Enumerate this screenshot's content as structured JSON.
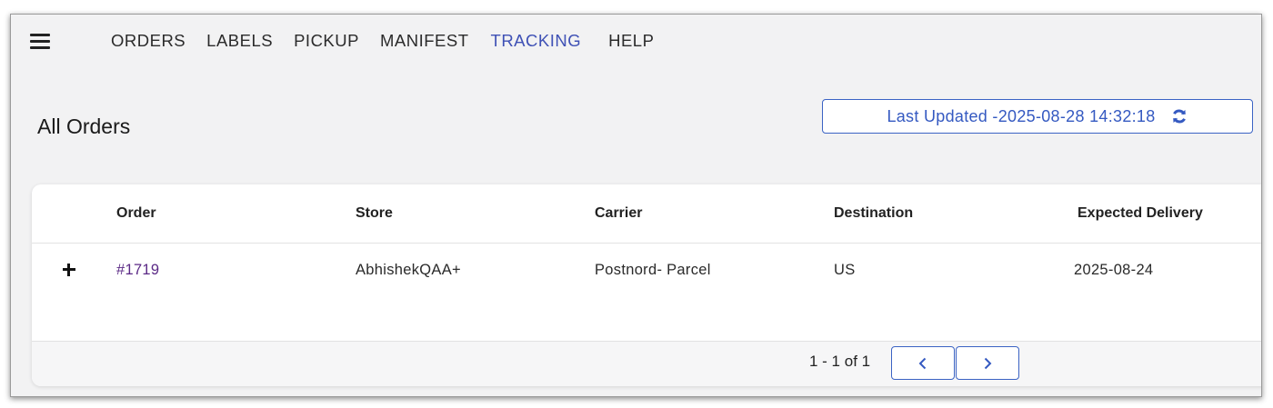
{
  "nav": {
    "items": [
      {
        "label": "ORDERS"
      },
      {
        "label": "LABELS"
      },
      {
        "label": "PICKUP"
      },
      {
        "label": "MANIFEST"
      },
      {
        "label": "TRACKING",
        "active": true
      },
      {
        "label": "HELP"
      }
    ]
  },
  "page": {
    "title": "All Orders"
  },
  "last_updated": {
    "label": "Last Updated -2025-08-28 14:32:18",
    "icon": "refresh-icon"
  },
  "table": {
    "columns": [
      "Order",
      "Store",
      "Carrier",
      "Destination",
      "Expected Delivery"
    ],
    "rows": [
      {
        "order": "#1719",
        "store": "AbhishekQAA+",
        "carrier": "Postnord- Parcel",
        "destination": "US",
        "expected_delivery": "2025-08-24"
      }
    ]
  },
  "pagination": {
    "info": "1 - 1 of 1",
    "prev_icon": "chevron-left-icon",
    "next_icon": "chevron-right-icon"
  },
  "colors": {
    "accent": "#3b63c4",
    "active_nav": "#3f51b5",
    "order_link": "#5b2a86"
  }
}
